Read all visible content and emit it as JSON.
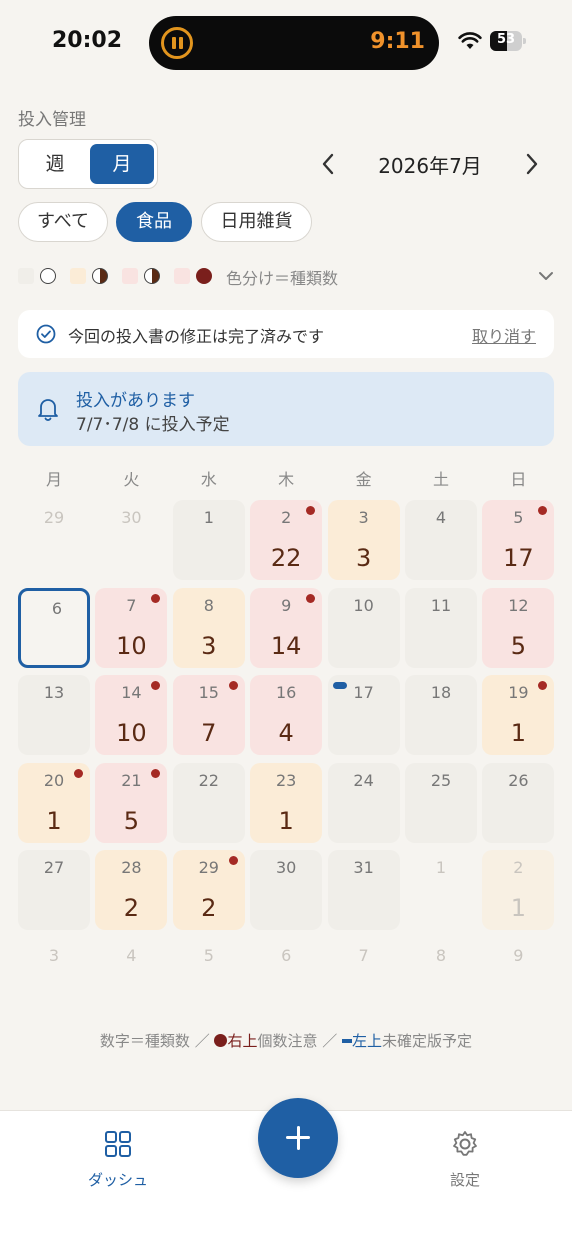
{
  "status_bar": {
    "time": "20:02",
    "island_timer": "9:11",
    "battery": "53",
    "battery_level": 0.53
  },
  "header": {
    "section_title": "投入管理"
  },
  "view_toggle": {
    "week": "週",
    "month": "月",
    "selected": "月"
  },
  "month_nav": {
    "label": "2026年7月",
    "prev_icon": "chevron-left-icon",
    "next_icon": "chevron-right-icon"
  },
  "filters": {
    "all": "すべて",
    "food": "食品",
    "goods": "日用雑貨",
    "selected": "食品"
  },
  "legend": {
    "text": "色分け＝種類数",
    "colors": [
      "#f0eee9",
      "#fbecd7",
      "#f9e3e1",
      "#a52a24"
    ]
  },
  "notice": {
    "text": "今回の投入書の修正は完了済みです",
    "undo": "取り消す"
  },
  "alert": {
    "title": "投入があります",
    "subtitle": "7/7･7/8 に投入予定"
  },
  "weekdays": [
    "月",
    "火",
    "水",
    "木",
    "金",
    "土",
    "日"
  ],
  "calendar": [
    [
      {
        "day": "29",
        "muted": true
      },
      {
        "day": "30",
        "muted": true
      },
      {
        "day": "1",
        "bg": "empty"
      },
      {
        "day": "2",
        "count": "22",
        "bg": "pink",
        "dot": true
      },
      {
        "day": "3",
        "count": "3",
        "bg": "orange"
      },
      {
        "day": "4",
        "bg": "empty"
      },
      {
        "day": "5",
        "count": "17",
        "bg": "pink",
        "dot": true
      }
    ],
    [
      {
        "day": "6",
        "today": true
      },
      {
        "day": "7",
        "count": "10",
        "bg": "pink",
        "dot": true
      },
      {
        "day": "8",
        "count": "3",
        "bg": "orange"
      },
      {
        "day": "9",
        "count": "14",
        "bg": "pink",
        "dot": true
      },
      {
        "day": "10",
        "bg": "empty"
      },
      {
        "day": "11",
        "bg": "empty"
      },
      {
        "day": "12",
        "count": "5",
        "bg": "pink"
      }
    ],
    [
      {
        "day": "13",
        "bg": "empty"
      },
      {
        "day": "14",
        "count": "10",
        "bg": "pink",
        "dot": true
      },
      {
        "day": "15",
        "count": "7",
        "bg": "pink",
        "dot": true
      },
      {
        "day": "16",
        "count": "4",
        "bg": "pink"
      },
      {
        "day": "17",
        "bg": "empty",
        "bar": true
      },
      {
        "day": "18",
        "bg": "empty"
      },
      {
        "day": "19",
        "count": "1",
        "bg": "orange",
        "dot": true
      }
    ],
    [
      {
        "day": "20",
        "count": "1",
        "bg": "orange",
        "dot": true
      },
      {
        "day": "21",
        "count": "5",
        "bg": "pink",
        "dot": true
      },
      {
        "day": "22",
        "bg": "empty"
      },
      {
        "day": "23",
        "count": "1",
        "bg": "orange"
      },
      {
        "day": "24",
        "bg": "empty"
      },
      {
        "day": "25",
        "bg": "empty"
      },
      {
        "day": "26",
        "bg": "empty"
      }
    ],
    [
      {
        "day": "27",
        "bg": "empty"
      },
      {
        "day": "28",
        "count": "2",
        "bg": "orange"
      },
      {
        "day": "29",
        "count": "2",
        "bg": "orange",
        "dot": true
      },
      {
        "day": "30",
        "bg": "empty"
      },
      {
        "day": "31",
        "bg": "empty"
      },
      {
        "day": "1",
        "muted": true
      },
      {
        "day": "2",
        "count": "1",
        "muted": true,
        "bg": "out-orange"
      }
    ],
    [
      {
        "day": "3",
        "muted": true
      },
      {
        "day": "4",
        "muted": true
      },
      {
        "day": "5",
        "muted": true
      },
      {
        "day": "6",
        "muted": true
      },
      {
        "day": "7",
        "muted": true
      },
      {
        "day": "8",
        "muted": true
      },
      {
        "day": "9",
        "muted": true
      }
    ]
  ],
  "footnote": {
    "part1": "数字＝種類数 ／ ",
    "red_label": "右上",
    "part2": "個数注意 ／ ",
    "blue_label": "左上",
    "part3": "未確定版予定"
  },
  "tabbar": {
    "dashboard": "ダッシュ",
    "settings": "設定",
    "dashboard_icon": "grid-icon",
    "settings_icon": "gear-icon",
    "fab_icon": "plus-icon"
  }
}
